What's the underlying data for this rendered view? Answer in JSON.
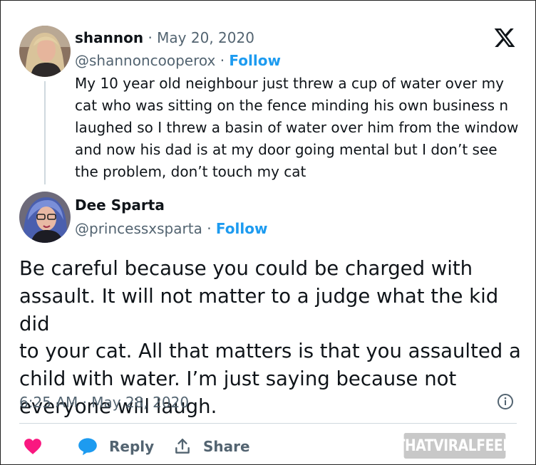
{
  "original": {
    "display_name": "shannon",
    "separator": "·",
    "date": "May 20, 2020",
    "handle": "@shannoncooperox",
    "follow_label": "Follow",
    "text": "My 10 year old neighbour just threw a cup of water over my\ncat who was sitting on the fence minding his own business n\nlaughed so I threw a basin of water over him from the window\nand now his dad is at my door going mental but I don’t see\nthe problem, don’t touch my cat"
  },
  "reply": {
    "display_name": "Dee Sparta",
    "separator": "·",
    "handle": "@princessxsparta",
    "follow_label": "Follow",
    "text": "Be careful because you could be charged with\nassault. It will not matter to a judge what the kid did\nto your cat. All that matters is that you assaulted a\nchild with water. I’m just saying because not\neveryone will laugh.",
    "timestamp": "6:25 AM · May 28, 2020"
  },
  "actions": {
    "reply_label": "Reply",
    "share_label": "Share"
  },
  "watermark": "THATVIRALFEED",
  "icons": [
    "x-logo-icon",
    "info-icon",
    "heart-icon",
    "reply-bubble-icon",
    "share-icon"
  ],
  "colors": {
    "accent": "#1d9bf0",
    "heart": "#f91880",
    "muted": "#536471"
  }
}
